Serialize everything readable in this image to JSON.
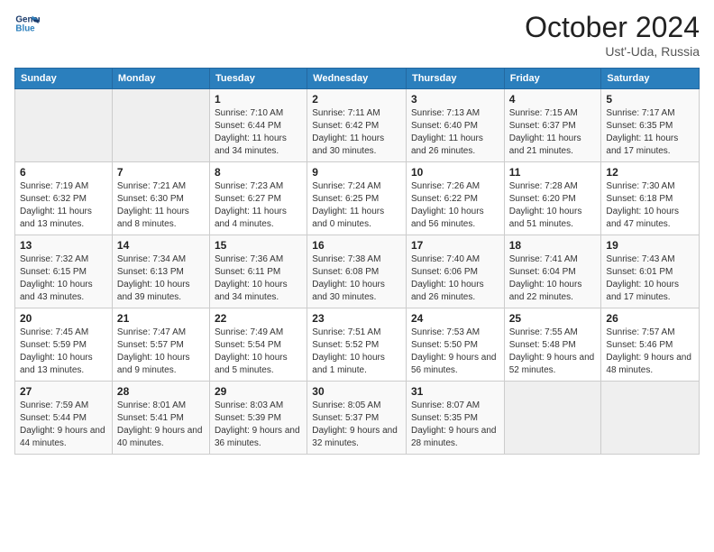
{
  "logo": {
    "line1": "General",
    "line2": "Blue"
  },
  "title": "October 2024",
  "subtitle": "Ust'-Uda, Russia",
  "days_header": [
    "Sunday",
    "Monday",
    "Tuesday",
    "Wednesday",
    "Thursday",
    "Friday",
    "Saturday"
  ],
  "weeks": [
    [
      {
        "day": "",
        "info": ""
      },
      {
        "day": "",
        "info": ""
      },
      {
        "day": "1",
        "info": "Sunrise: 7:10 AM\nSunset: 6:44 PM\nDaylight: 11 hours and 34 minutes."
      },
      {
        "day": "2",
        "info": "Sunrise: 7:11 AM\nSunset: 6:42 PM\nDaylight: 11 hours and 30 minutes."
      },
      {
        "day": "3",
        "info": "Sunrise: 7:13 AM\nSunset: 6:40 PM\nDaylight: 11 hours and 26 minutes."
      },
      {
        "day": "4",
        "info": "Sunrise: 7:15 AM\nSunset: 6:37 PM\nDaylight: 11 hours and 21 minutes."
      },
      {
        "day": "5",
        "info": "Sunrise: 7:17 AM\nSunset: 6:35 PM\nDaylight: 11 hours and 17 minutes."
      }
    ],
    [
      {
        "day": "6",
        "info": "Sunrise: 7:19 AM\nSunset: 6:32 PM\nDaylight: 11 hours and 13 minutes."
      },
      {
        "day": "7",
        "info": "Sunrise: 7:21 AM\nSunset: 6:30 PM\nDaylight: 11 hours and 8 minutes."
      },
      {
        "day": "8",
        "info": "Sunrise: 7:23 AM\nSunset: 6:27 PM\nDaylight: 11 hours and 4 minutes."
      },
      {
        "day": "9",
        "info": "Sunrise: 7:24 AM\nSunset: 6:25 PM\nDaylight: 11 hours and 0 minutes."
      },
      {
        "day": "10",
        "info": "Sunrise: 7:26 AM\nSunset: 6:22 PM\nDaylight: 10 hours and 56 minutes."
      },
      {
        "day": "11",
        "info": "Sunrise: 7:28 AM\nSunset: 6:20 PM\nDaylight: 10 hours and 51 minutes."
      },
      {
        "day": "12",
        "info": "Sunrise: 7:30 AM\nSunset: 6:18 PM\nDaylight: 10 hours and 47 minutes."
      }
    ],
    [
      {
        "day": "13",
        "info": "Sunrise: 7:32 AM\nSunset: 6:15 PM\nDaylight: 10 hours and 43 minutes."
      },
      {
        "day": "14",
        "info": "Sunrise: 7:34 AM\nSunset: 6:13 PM\nDaylight: 10 hours and 39 minutes."
      },
      {
        "day": "15",
        "info": "Sunrise: 7:36 AM\nSunset: 6:11 PM\nDaylight: 10 hours and 34 minutes."
      },
      {
        "day": "16",
        "info": "Sunrise: 7:38 AM\nSunset: 6:08 PM\nDaylight: 10 hours and 30 minutes."
      },
      {
        "day": "17",
        "info": "Sunrise: 7:40 AM\nSunset: 6:06 PM\nDaylight: 10 hours and 26 minutes."
      },
      {
        "day": "18",
        "info": "Sunrise: 7:41 AM\nSunset: 6:04 PM\nDaylight: 10 hours and 22 minutes."
      },
      {
        "day": "19",
        "info": "Sunrise: 7:43 AM\nSunset: 6:01 PM\nDaylight: 10 hours and 17 minutes."
      }
    ],
    [
      {
        "day": "20",
        "info": "Sunrise: 7:45 AM\nSunset: 5:59 PM\nDaylight: 10 hours and 13 minutes."
      },
      {
        "day": "21",
        "info": "Sunrise: 7:47 AM\nSunset: 5:57 PM\nDaylight: 10 hours and 9 minutes."
      },
      {
        "day": "22",
        "info": "Sunrise: 7:49 AM\nSunset: 5:54 PM\nDaylight: 10 hours and 5 minutes."
      },
      {
        "day": "23",
        "info": "Sunrise: 7:51 AM\nSunset: 5:52 PM\nDaylight: 10 hours and 1 minute."
      },
      {
        "day": "24",
        "info": "Sunrise: 7:53 AM\nSunset: 5:50 PM\nDaylight: 9 hours and 56 minutes."
      },
      {
        "day": "25",
        "info": "Sunrise: 7:55 AM\nSunset: 5:48 PM\nDaylight: 9 hours and 52 minutes."
      },
      {
        "day": "26",
        "info": "Sunrise: 7:57 AM\nSunset: 5:46 PM\nDaylight: 9 hours and 48 minutes."
      }
    ],
    [
      {
        "day": "27",
        "info": "Sunrise: 7:59 AM\nSunset: 5:44 PM\nDaylight: 9 hours and 44 minutes."
      },
      {
        "day": "28",
        "info": "Sunrise: 8:01 AM\nSunset: 5:41 PM\nDaylight: 9 hours and 40 minutes."
      },
      {
        "day": "29",
        "info": "Sunrise: 8:03 AM\nSunset: 5:39 PM\nDaylight: 9 hours and 36 minutes."
      },
      {
        "day": "30",
        "info": "Sunrise: 8:05 AM\nSunset: 5:37 PM\nDaylight: 9 hours and 32 minutes."
      },
      {
        "day": "31",
        "info": "Sunrise: 8:07 AM\nSunset: 5:35 PM\nDaylight: 9 hours and 28 minutes."
      },
      {
        "day": "",
        "info": ""
      },
      {
        "day": "",
        "info": ""
      }
    ]
  ]
}
